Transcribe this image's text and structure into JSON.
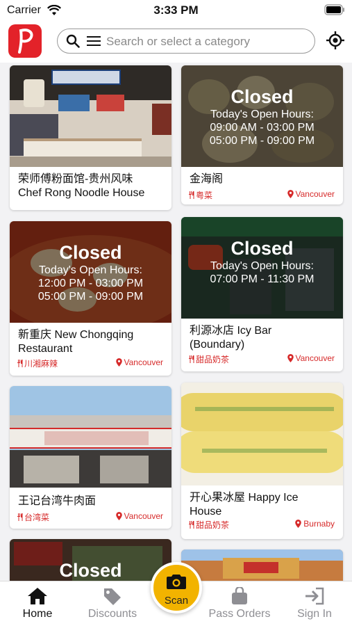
{
  "status_bar": {
    "carrier": "Carrier",
    "time": "3:33 PM"
  },
  "header": {
    "logo_letter": "P",
    "search_placeholder": "Search or select a category"
  },
  "restaurants": [
    {
      "name": "荣师傅粉面馆-贵州风味\nChef Rong Noodle House",
      "category": "",
      "location": "",
      "closed": false
    },
    {
      "name": "金海阁",
      "category": "粤菜",
      "location": "Vancouver",
      "closed": true,
      "closed_label": "Closed",
      "hours_title": "Today's Open Hours:",
      "hours": [
        "09:00 AM - 03:00 PM",
        "05:00 PM - 09:00 PM"
      ]
    },
    {
      "name": "新重庆 New Chongqing\nRestaurant",
      "category": "川湘麻辣",
      "location": "Vancouver",
      "closed": true,
      "closed_label": "Closed",
      "hours_title": "Today's Open Hours:",
      "hours": [
        "12:00 PM - 03:00 PM",
        "05:00 PM - 09:00 PM"
      ]
    },
    {
      "name": "利源冰店 Icy Bar\n(Boundary)",
      "category": "甜品奶茶",
      "location": "Vancouver",
      "closed": true,
      "closed_label": "Closed",
      "hours_title": "Today's Open Hours:",
      "hours": [
        "07:00 PM - 11:30 PM"
      ]
    },
    {
      "name": "王记台湾牛肉面",
      "category": "台湾菜",
      "location": "Vancouver",
      "closed": false
    },
    {
      "name": "开心果冰屋 Happy Ice\nHouse",
      "category": "甜品奶茶",
      "location": "Burnaby",
      "closed": false
    },
    {
      "name": "",
      "category": "",
      "location": "",
      "closed": true,
      "closed_label": "Closed"
    },
    {
      "name": "",
      "category": "",
      "location": "",
      "closed": false
    }
  ],
  "tabs": [
    {
      "label": "Home",
      "icon": "home-icon"
    },
    {
      "label": "Discounts",
      "icon": "tag-icon"
    },
    {
      "label": "Scan",
      "icon": "camera-icon"
    },
    {
      "label": "Pass Orders",
      "icon": "bag-icon"
    },
    {
      "label": "Sign In",
      "icon": "sign-in-icon"
    }
  ],
  "colors": {
    "brand_red": "#e32229",
    "scan_yellow": "#f2b300",
    "tag_red": "#d62a2a"
  }
}
